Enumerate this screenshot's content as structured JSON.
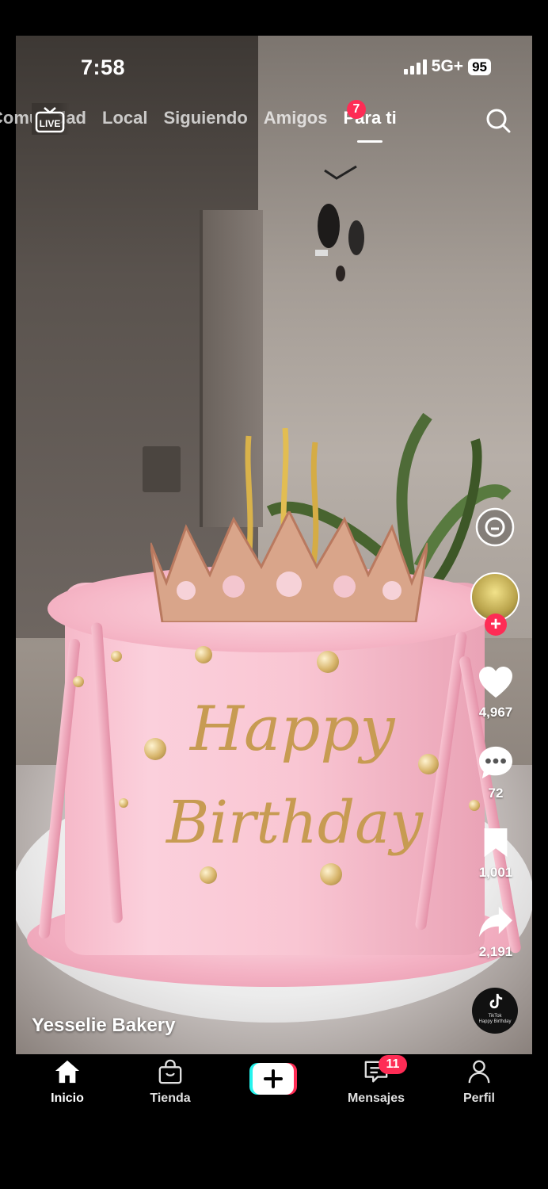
{
  "status_bar": {
    "time": "7:58",
    "network": "5G+",
    "battery": "95"
  },
  "top_nav": {
    "tabs": [
      {
        "label": "Comunidad",
        "active": false
      },
      {
        "label": "Local",
        "active": false
      },
      {
        "label": "Siguiendo",
        "active": false
      },
      {
        "label": "Amigos",
        "active": false,
        "badge": "7"
      },
      {
        "label": "Para ti",
        "active": true
      }
    ],
    "live_label": "LIVE"
  },
  "video": {
    "author": "Yesselie Bakery",
    "topper_text": [
      "Happy",
      "Birthday"
    ]
  },
  "actions": {
    "likes": "4,967",
    "comments": "72",
    "saves": "1,001",
    "shares": "2,191"
  },
  "sound": {
    "brand": "TikTok",
    "title": "Happy Birthday"
  },
  "bottom_nav": {
    "items": [
      {
        "label": "Inicio"
      },
      {
        "label": "Tienda"
      },
      {
        "label": ""
      },
      {
        "label": "Mensajes",
        "badge": "11"
      },
      {
        "label": "Perfil"
      }
    ]
  },
  "colors": {
    "accent": "#fe2c55",
    "create_left": "#25f4ee",
    "create_right": "#fe2c55"
  }
}
